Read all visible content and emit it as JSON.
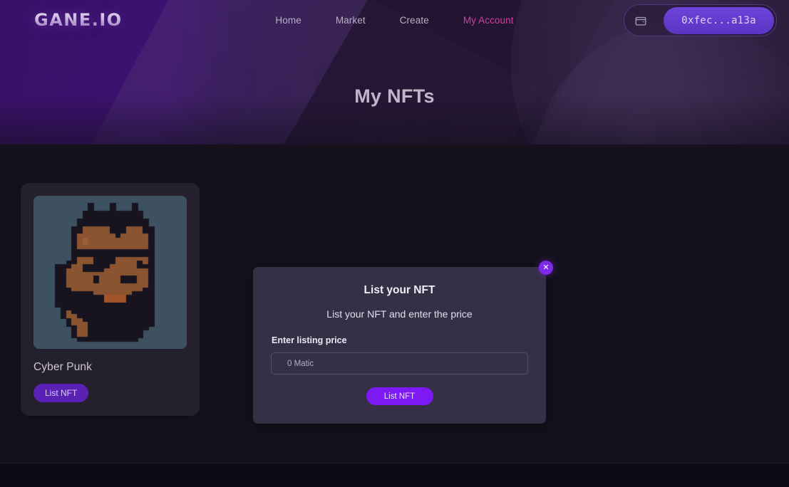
{
  "brand": {
    "logo": "GANE.IO"
  },
  "nav": {
    "links": [
      {
        "label": "Home",
        "active": false
      },
      {
        "label": "Market",
        "active": false
      },
      {
        "label": "Create",
        "active": false
      },
      {
        "label": "My Account",
        "active": true
      }
    ],
    "wallet": {
      "address": "0xfec...a13a",
      "icon": "wallet-icon"
    }
  },
  "hero": {
    "title": "My NFTs"
  },
  "cards": [
    {
      "title": "Cyber Punk",
      "button": "List NFT",
      "image_alt": "pixel-art-cyberpunk-avatar"
    }
  ],
  "modal": {
    "title": "List your NFT",
    "subtitle": "List your NFT and enter the price",
    "field_label": "Enter listing price",
    "input_value": "",
    "input_placeholder": "0 Matic",
    "submit": "List NFT",
    "close": "✕"
  },
  "colors": {
    "accent_purple": "#7c19f5",
    "card_button_purple": "#5b21b6",
    "active_nav_pink": "#cf3fa0",
    "page_bg": "#15121e",
    "card_bg": "#24202e",
    "modal_bg": "#353045",
    "nft_image_bg": "#3d5160"
  },
  "punk_art": {
    "bg": "#3d5160",
    "dark": "#17141f",
    "skin": "#8a5430",
    "skin_light": "#9c6038",
    "mouth": "#a2542a",
    "grid": 28,
    "rows": [
      "............................",
      "............................",
      "..........X...X...X.........",
      "..........X...X...X.........",
      ".........XXXXXXXXXXX........",
      ".........XXXXXXXXXXX........",
      "........XXXXXXXXXXXXX.......",
      "........XXXXXXXXXXXXX.......",
      ".......XXSSSSSXXXSSSXX......",
      ".......XXSSSSSXXXSSSXX......",
      ".......XSSSSSSSXSSSSSX......",
      ".......XSLSSSSSSSSSSSX......",
      ".......XSLSSSSSSSSSSSX......",
      ".......XSSSSSSSSSSSSSX......",
      ".......XXXXXXXXXXXXXXX......",
      ".......XXXXXXXXXXXXXXX......",
      ".......XSSSXXXXSSSSSSX......",
      "......XXSSSXXXXSSSSXSX......",
      "....XXXSSXXXXXSSSSSXXX......",
      "....XXSSSXXXXSSSSSSSSX......",
      "....XXSSSSSSSSSSSSSSSX......",
      "....XXSSSSSXSSSSXXXSSX......",
      "....XXSSSSSXSSSSXXXSSX......",
      "....XXSSSSSSSSSSSSSSSX......",
      "....XXXSSSSSSSSSSSSSXX......",
      "....XXXXXXXSSSSSSSXXXX......",
      "....XXXXXXXXXMMMMXXXXX......",
      "....XXXXXXXXXMMMMXXXXX......",
      "....XXXXXXXXXXXXXXXXXX......",
      ".....XXXXXXXXXXXXXXXXX......",
      ".....XSXXXXXXXXXXXXXXX......",
      ".....XSSXXXXXXXXXXXXXX......",
      "......XSSXXXXXXXXXXXXX......",
      "......XSSSXXXXXXXXXXXX......",
      ".......XSSXXXXXXXXXXX.......",
      ".......XSSXXXXXXXXXX........",
      ".......XSSXXXXXXXXXX........",
      "........XXXXXXXXXXX.........",
      "............................",
      "............................"
    ]
  }
}
